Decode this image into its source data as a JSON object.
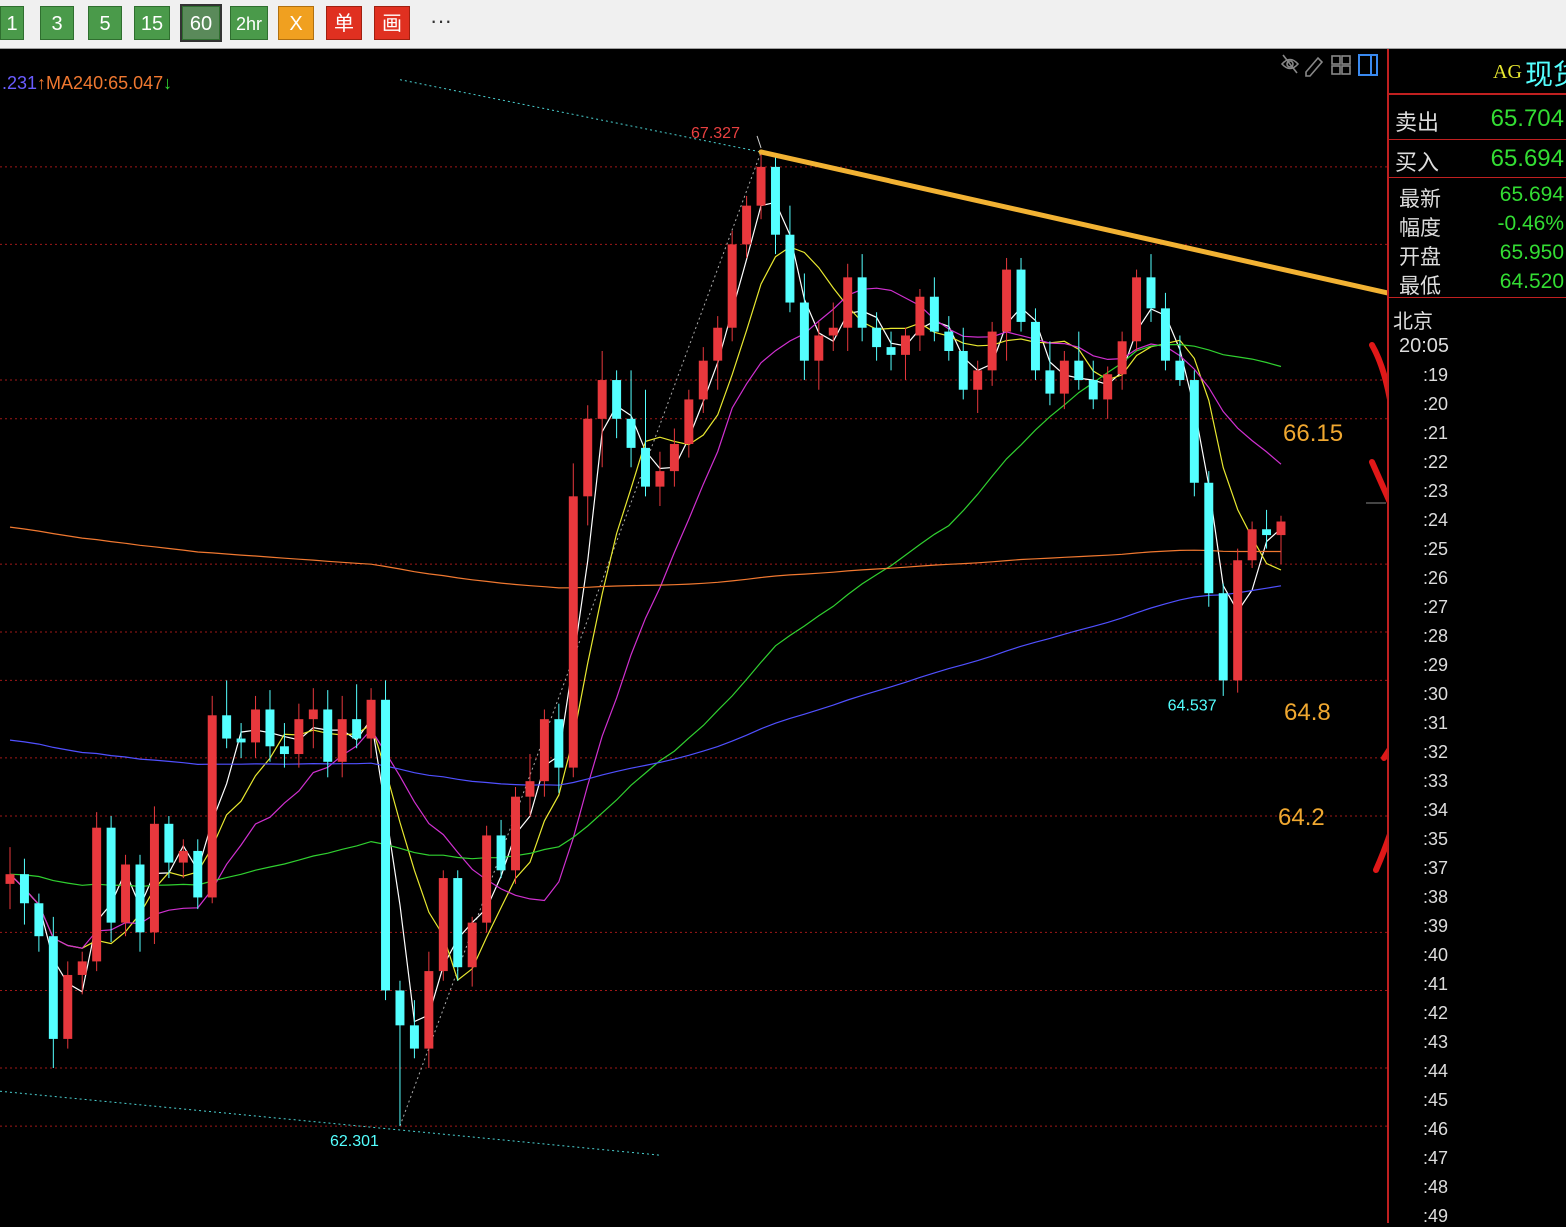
{
  "toolbar": {
    "buttons": [
      {
        "label": "1"
      },
      {
        "label": "3"
      },
      {
        "label": "5"
      },
      {
        "label": "15"
      },
      {
        "label": "60",
        "active": true
      },
      {
        "label": "2hr"
      }
    ],
    "icons": [
      {
        "label": "X",
        "name": "x-tool-icon",
        "color": "#f0a020"
      },
      {
        "label": "单",
        "name": "order-icon",
        "color": "#e03020"
      },
      {
        "label": "画",
        "name": "draw-icon",
        "color": "#e03020"
      }
    ],
    "more_label": "···"
  },
  "ma_legend": {
    "part1": ".231",
    "part1_color": "#6a5cff",
    "part2": "↑MA240:65.047",
    "part2_color": "#f07830",
    "part3": "↓",
    "part3_color": "#33dd33"
  },
  "annotations": {
    "high_label": "67.327",
    "low_label": "62.301",
    "recent_low_label": "64.537",
    "level_1": "66.15",
    "level_2": "64.8",
    "level_3": "64.2"
  },
  "side_panel": {
    "prefix": "AG",
    "title": "现货",
    "sell": {
      "label": "卖出",
      "value": "65.704"
    },
    "buy": {
      "label": "买入",
      "value": "65.694"
    },
    "latest": {
      "label": "最新",
      "value": "65.694"
    },
    "change": {
      "label": "幅度",
      "value": "-0.46%"
    },
    "open": {
      "label": "开盘",
      "value": "65.950"
    },
    "low": {
      "label": "最低",
      "value": "64.520"
    },
    "city": "北京",
    "time_first": "20:05",
    "times": [
      ":19",
      ":20",
      ":21",
      ":22",
      ":23",
      ":24",
      ":25",
      ":26",
      ":27",
      ":28",
      ":29",
      ":30",
      ":31",
      ":32",
      ":33",
      ":34",
      ":35",
      ":37",
      ":38",
      ":39",
      ":40",
      ":41",
      ":42",
      ":43",
      ":44",
      ":45",
      ":46",
      ":47",
      ":48",
      ":49"
    ]
  },
  "colors": {
    "up": "#e8383d",
    "down": "#54ffff",
    "ma5": "#ffffff",
    "ma10": "#e8e830",
    "ma20": "#d030d0",
    "ma60": "#30d030",
    "ma120": "#5050ff",
    "ma240": "#f07830"
  },
  "chart_data": {
    "type": "candlestick",
    "ylim": [
      62.0,
      67.5
    ],
    "annotations": [
      {
        "text": "67.327",
        "value": 67.327
      },
      {
        "text": "62.301",
        "value": 62.301
      },
      {
        "text": "64.537",
        "value": 64.537
      }
    ],
    "horizontal_levels": [
      66.15,
      64.8,
      64.2
    ],
    "legend": [
      "MA240:65.047"
    ],
    "candles": [
      [
        63.55,
        63.74,
        63.42,
        63.6
      ],
      [
        63.6,
        63.68,
        63.34,
        63.45
      ],
      [
        63.45,
        63.5,
        63.2,
        63.28
      ],
      [
        63.28,
        63.38,
        62.6,
        62.75
      ],
      [
        62.75,
        63.15,
        62.7,
        63.08
      ],
      [
        63.08,
        63.2,
        62.98,
        63.15
      ],
      [
        63.15,
        63.92,
        63.1,
        63.84
      ],
      [
        63.84,
        63.9,
        63.25,
        63.35
      ],
      [
        63.35,
        63.7,
        63.28,
        63.65
      ],
      [
        63.65,
        63.7,
        63.2,
        63.3
      ],
      [
        63.3,
        63.95,
        63.24,
        63.86
      ],
      [
        63.86,
        63.9,
        63.58,
        63.66
      ],
      [
        63.66,
        63.78,
        63.58,
        63.72
      ],
      [
        63.72,
        63.78,
        63.42,
        63.48
      ],
      [
        63.48,
        64.52,
        63.45,
        64.42
      ],
      [
        64.42,
        64.6,
        64.25,
        64.3
      ],
      [
        64.3,
        64.38,
        64.2,
        64.28
      ],
      [
        64.28,
        64.52,
        64.2,
        64.45
      ],
      [
        64.45,
        64.55,
        64.18,
        64.26
      ],
      [
        64.26,
        64.38,
        64.15,
        64.22
      ],
      [
        64.22,
        64.48,
        64.15,
        64.4
      ],
      [
        64.4,
        64.56,
        64.25,
        64.45
      ],
      [
        64.45,
        64.55,
        64.1,
        64.18
      ],
      [
        64.18,
        64.52,
        64.1,
        64.4
      ],
      [
        64.4,
        64.58,
        64.25,
        64.3
      ],
      [
        64.3,
        64.56,
        64.2,
        64.5
      ],
      [
        64.5,
        64.6,
        62.95,
        63.0
      ],
      [
        63.0,
        63.05,
        62.3,
        62.82
      ],
      [
        62.82,
        62.95,
        62.65,
        62.7
      ],
      [
        62.7,
        63.2,
        62.6,
        63.1
      ],
      [
        63.1,
        63.62,
        63.05,
        63.58
      ],
      [
        63.58,
        63.62,
        63.05,
        63.12
      ],
      [
        63.12,
        63.38,
        63.02,
        63.35
      ],
      [
        63.35,
        63.85,
        63.3,
        63.8
      ],
      [
        63.8,
        63.88,
        63.58,
        63.62
      ],
      [
        63.62,
        64.05,
        63.55,
        64.0
      ],
      [
        64.0,
        64.22,
        63.9,
        64.08
      ],
      [
        64.08,
        64.45,
        64.0,
        64.4
      ],
      [
        64.4,
        64.48,
        64.02,
        64.15
      ],
      [
        64.15,
        65.72,
        64.1,
        65.55
      ],
      [
        65.55,
        66.02,
        65.4,
        65.95
      ],
      [
        65.95,
        66.3,
        65.7,
        66.15
      ],
      [
        66.15,
        66.2,
        65.85,
        65.95
      ],
      [
        65.95,
        66.2,
        65.7,
        65.8
      ],
      [
        65.8,
        66.1,
        65.55,
        65.6
      ],
      [
        65.6,
        65.78,
        65.5,
        65.68
      ],
      [
        65.68,
        65.9,
        65.6,
        65.82
      ],
      [
        65.82,
        66.1,
        65.75,
        66.05
      ],
      [
        66.05,
        66.32,
        65.98,
        66.25
      ],
      [
        66.25,
        66.48,
        66.1,
        66.42
      ],
      [
        66.42,
        66.92,
        66.35,
        66.85
      ],
      [
        66.85,
        67.1,
        66.78,
        67.05
      ],
      [
        67.05,
        67.33,
        66.98,
        67.25
      ],
      [
        67.25,
        67.3,
        66.8,
        66.9
      ],
      [
        66.9,
        67.05,
        66.5,
        66.55
      ],
      [
        66.55,
        66.7,
        66.15,
        66.25
      ],
      [
        66.25,
        66.45,
        66.1,
        66.38
      ],
      [
        66.38,
        66.55,
        66.3,
        66.42
      ],
      [
        66.42,
        66.75,
        66.3,
        66.68
      ],
      [
        66.68,
        66.8,
        66.35,
        66.42
      ],
      [
        66.42,
        66.5,
        66.25,
        66.32
      ],
      [
        66.32,
        66.4,
        66.2,
        66.28
      ],
      [
        66.28,
        66.42,
        66.15,
        66.38
      ],
      [
        66.38,
        66.62,
        66.3,
        66.58
      ],
      [
        66.58,
        66.68,
        66.35,
        66.4
      ],
      [
        66.4,
        66.48,
        66.25,
        66.3
      ],
      [
        66.3,
        66.42,
        66.05,
        66.1
      ],
      [
        66.1,
        66.25,
        65.98,
        66.2
      ],
      [
        66.2,
        66.45,
        66.12,
        66.4
      ],
      [
        66.4,
        66.78,
        66.25,
        66.72
      ],
      [
        66.72,
        66.78,
        66.4,
        66.45
      ],
      [
        66.45,
        66.52,
        66.15,
        66.2
      ],
      [
        66.2,
        66.35,
        66.02,
        66.08
      ],
      [
        66.08,
        66.3,
        66.0,
        66.25
      ],
      [
        66.25,
        66.4,
        66.1,
        66.15
      ],
      [
        66.15,
        66.25,
        66.0,
        66.05
      ],
      [
        66.05,
        66.22,
        65.95,
        66.18
      ],
      [
        66.18,
        66.4,
        66.1,
        66.35
      ],
      [
        66.35,
        66.72,
        66.3,
        66.68
      ],
      [
        66.68,
        66.8,
        66.45,
        66.52
      ],
      [
        66.52,
        66.6,
        66.2,
        66.25
      ],
      [
        66.25,
        66.38,
        66.12,
        66.15
      ],
      [
        66.15,
        66.2,
        65.55,
        65.62
      ],
      [
        65.62,
        65.68,
        64.98,
        65.05
      ],
      [
        65.05,
        65.1,
        64.52,
        64.6
      ],
      [
        64.6,
        65.28,
        64.537,
        65.22
      ],
      [
        65.22,
        65.42,
        65.18,
        65.38
      ],
      [
        65.38,
        65.48,
        65.28,
        65.35
      ],
      [
        65.35,
        65.45,
        65.2,
        65.42
      ]
    ]
  }
}
